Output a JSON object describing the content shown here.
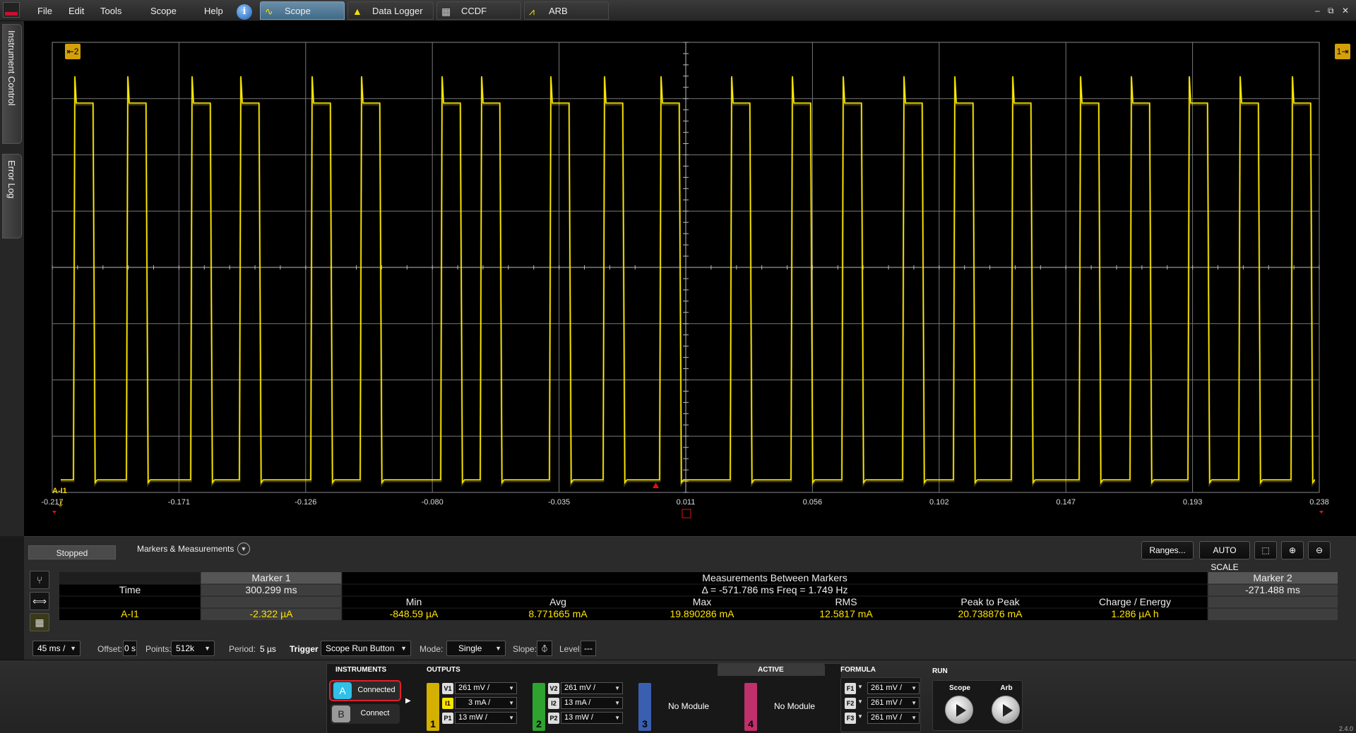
{
  "menu": {
    "file": "File",
    "edit": "Edit",
    "tools": "Tools",
    "scope": "Scope",
    "help": "Help"
  },
  "tabs": [
    {
      "label": "Scope",
      "active": true
    },
    {
      "label": "Data Logger",
      "active": false
    },
    {
      "label": "CCDF",
      "active": false
    },
    {
      "label": "ARB",
      "active": false
    }
  ],
  "window_buttons": {
    "minimize": "–",
    "restore": "⧉",
    "close": "✕"
  },
  "side_tabs": {
    "instrument_control": "Instrument Control",
    "error_log": "Error Log"
  },
  "scope": {
    "marker_left_label": "2",
    "marker_right_label": "1",
    "channel_label": "A-I1",
    "x_ticks": [
      "-0.217",
      "-0.171",
      "-0.126",
      "-0.080",
      "-0.035",
      "0.011",
      "0.056",
      "0.102",
      "0.147",
      "0.193",
      "0.238"
    ],
    "trace_color": "#ffea00",
    "trigger_marker_color": "#e01010"
  },
  "nav": {
    "first": "<<",
    "prev": "<",
    "next": ">",
    "last": ">>"
  },
  "panel": {
    "status": "Stopped",
    "markers_measurements": "Markers & Measurements",
    "ranges": "Ranges...",
    "auto_scale": "AUTO SCALE"
  },
  "measurements": {
    "marker1_header": "Marker 1",
    "between_header": "Measurements Between Markers",
    "marker2_header": "Marker 2",
    "time_label": "Time",
    "marker1_time": "300.299 ms",
    "delta_text": "Δ = -571.786 ms   Freq = 1.749 Hz",
    "marker2_time": "-271.488 ms",
    "columns": [
      "Min",
      "Avg",
      "Max",
      "RMS",
      "Peak to Peak",
      "Charge / Energy"
    ],
    "channel": "A-I1",
    "marker1_value": "-2.322 µA",
    "values": [
      "-848.59 µA",
      "8.771665 mA",
      "19.890286 mA",
      "12.5817 mA",
      "20.738876 mA",
      "1.286 µA h"
    ],
    "marker2_value": ""
  },
  "toolbar": {
    "timebase": "45 ms /",
    "offset_label": "Offset:",
    "offset_value": "0 s",
    "points_label": "Points:",
    "points_value": "512k",
    "period_label": "Period:",
    "period_value": "5 µs",
    "trigger_label": "Trigger",
    "trigger_value": "Scope Run Button",
    "mode_label": "Mode:",
    "mode_value": "Single",
    "slope_label": "Slope:",
    "level_label": "Level:",
    "level_value": "---"
  },
  "controls": {
    "instruments_label": "INSTRUMENTS",
    "outputs_label": "OUTPUTS",
    "active_label": "ACTIVE",
    "formula_label": "FORMULA",
    "run_label": "RUN",
    "inst_a": "A",
    "inst_a_state": "Connected",
    "inst_b": "B",
    "inst_b_state": "Connect",
    "module1": {
      "num": "1",
      "color": "#d4b000",
      "rows": [
        {
          "tag": "V1",
          "value": "261 mV /"
        },
        {
          "tag": "I1",
          "value": "3 mA /"
        },
        {
          "tag": "P1",
          "value": "13 mW /"
        }
      ]
    },
    "module2": {
      "num": "2",
      "color": "#2fa32f",
      "rows": [
        {
          "tag": "V2",
          "value": "261 mV /"
        },
        {
          "tag": "I2",
          "value": "13 mA /"
        },
        {
          "tag": "P2",
          "value": "13 mW /"
        }
      ]
    },
    "module3": {
      "num": "3",
      "color": "#3a5fb0",
      "text": "No Module"
    },
    "module4": {
      "num": "4",
      "color": "#c0306a",
      "text": "No Module"
    },
    "formula": [
      {
        "tag": "F1",
        "value": "261 mV /"
      },
      {
        "tag": "F2",
        "value": "261 mV /"
      },
      {
        "tag": "F3",
        "value": "261 mV /"
      }
    ],
    "run_scope": "Scope",
    "run_arb": "Arb",
    "version": "2.4.0"
  }
}
